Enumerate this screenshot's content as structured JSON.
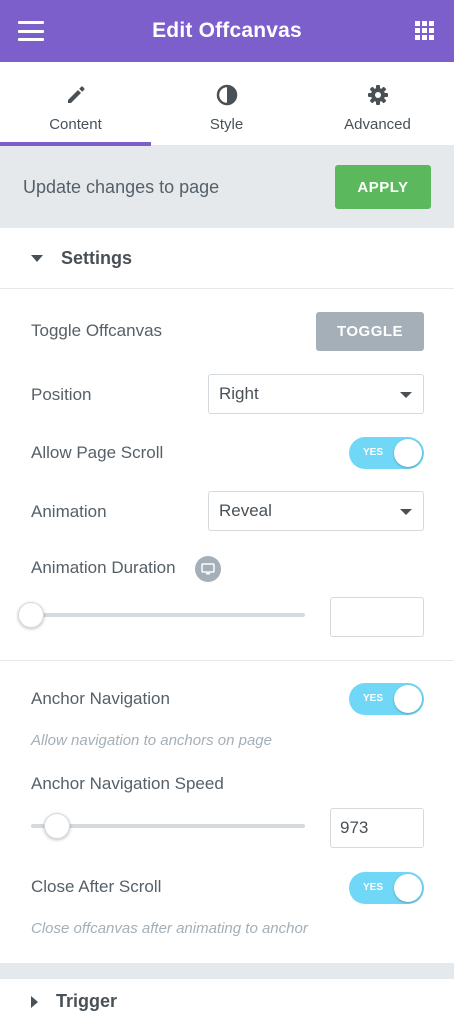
{
  "header": {
    "title": "Edit Offcanvas",
    "menu_icon": "hamburger-icon",
    "apps_icon": "grid-apps-icon",
    "color": "#7d5fcc"
  },
  "tabs": [
    {
      "label": "Content",
      "icon": "pencil-icon",
      "active": true
    },
    {
      "label": "Style",
      "icon": "contrast-circle-icon",
      "active": false
    },
    {
      "label": "Advanced",
      "icon": "gear-icon",
      "active": false
    }
  ],
  "update_bar": {
    "text": "Update changes to page",
    "button": "APPLY",
    "button_color": "#5cb85c"
  },
  "settings": {
    "title": "Settings",
    "toggle_offcanvas": {
      "label": "Toggle Offcanvas",
      "button": "TOGGLE"
    },
    "position": {
      "label": "Position",
      "value": "Right"
    },
    "allow_page_scroll": {
      "label": "Allow Page Scroll",
      "state": "YES"
    },
    "animation": {
      "label": "Animation",
      "value": "Reveal"
    },
    "animation_duration": {
      "label": "Animation Duration",
      "value": "",
      "device_icon": "desktop-icon",
      "slider_position": 0
    },
    "anchor_navigation": {
      "label": "Anchor Navigation",
      "state": "YES",
      "description": "Allow navigation to anchors on page"
    },
    "anchor_navigation_speed": {
      "label": "Anchor Navigation Speed",
      "value": "973"
    },
    "close_after_scroll": {
      "label": "Close After Scroll",
      "state": "YES",
      "description": "Close offcanvas after animating to anchor"
    }
  },
  "trigger": {
    "title": "Trigger"
  },
  "colors": {
    "switch_on": "#71d7f7",
    "toggle_button": "#a4afb7"
  }
}
